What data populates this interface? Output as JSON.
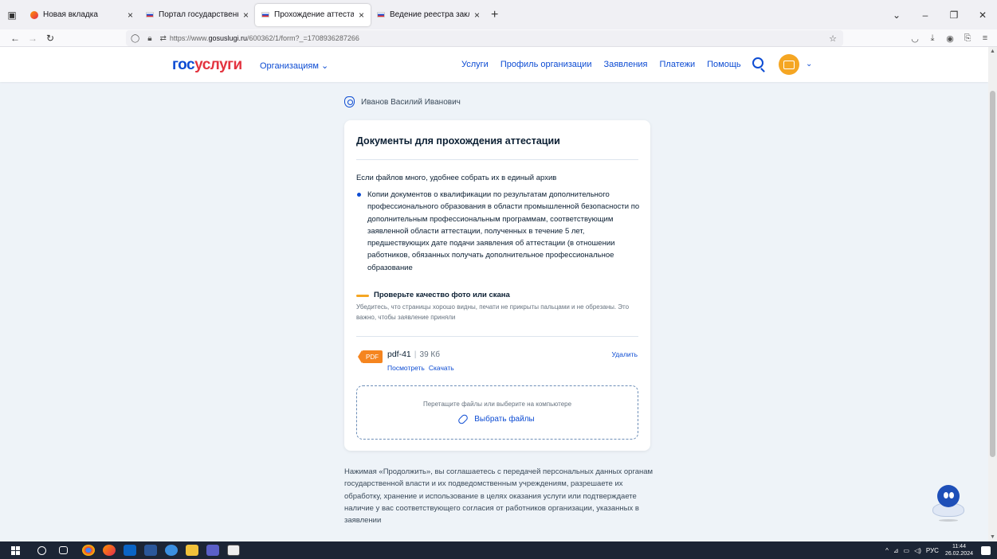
{
  "browser": {
    "tabs": [
      {
        "title": "Новая вкладка",
        "active": false,
        "favicon": "firefox-icon"
      },
      {
        "title": "Портал государственных услу",
        "active": false,
        "favicon": "flag-icon"
      },
      {
        "title": "Прохождение аттестации | По",
        "active": true,
        "favicon": "flag-icon"
      },
      {
        "title": "Ведение реестра заключений",
        "active": false,
        "favicon": "flag-icon"
      }
    ],
    "url_prefix": "https://www.",
    "url_host": "gosuslugi.ru",
    "url_path": "/600362/1/form?_=1708936287266"
  },
  "header": {
    "logo_part1": "гос",
    "logo_part2": "услуги",
    "org_menu": "Организациям",
    "nav": [
      "Услуги",
      "Профиль организации",
      "Заявления",
      "Платежи",
      "Помощь"
    ]
  },
  "user": {
    "name": "Иванов Василий Иванович"
  },
  "card": {
    "title": "Документы для прохождения аттестации",
    "hint": "Если файлов много, удобнее собрать их в единый архив",
    "bullet": "Копии документов о квалификации по результатам дополнительного профессионального образования в области промышленной безопасности по дополнительным профессиональным программам, соответствующим заявленной области аттестации, полученных в течение 5 лет, предшествующих дате подачи заявления об аттестации (в отношении работников, обязанных получать дополнительное профессиональное образование",
    "quality_title": "Проверьте качество фото или скана",
    "quality_desc": "Убедитесь, что страницы хорошо видны, печати не прикрыты пальцами и не обрезаны. Это важно, чтобы заявление приняли",
    "file": {
      "badge": "PDF",
      "name": "pdf-41",
      "size": "39 Кб",
      "view": "Посмотреть",
      "download": "Скачать",
      "delete": "Удалить"
    },
    "dropzone": {
      "hint": "Перетащите файлы или выберите на компьютере",
      "button": "Выбрать файлы"
    }
  },
  "consent": "Нажимая «Продолжить», вы соглашаетесь с передачей персональных данных органам государственной власти и их подведомственным учреждениям, разрешаете их обработку, хранение и использование в целях оказания услуги или подтверждаете наличие у вас соответствующего согласия от работников организации, указанных в заявлении",
  "taskbar": {
    "lang": "РУС",
    "time": "11:44",
    "date": "26.02.2024"
  },
  "colors": {
    "brand_blue": "#0d4cd3",
    "brand_red": "#e3333f",
    "accent_orange": "#f5a623"
  }
}
